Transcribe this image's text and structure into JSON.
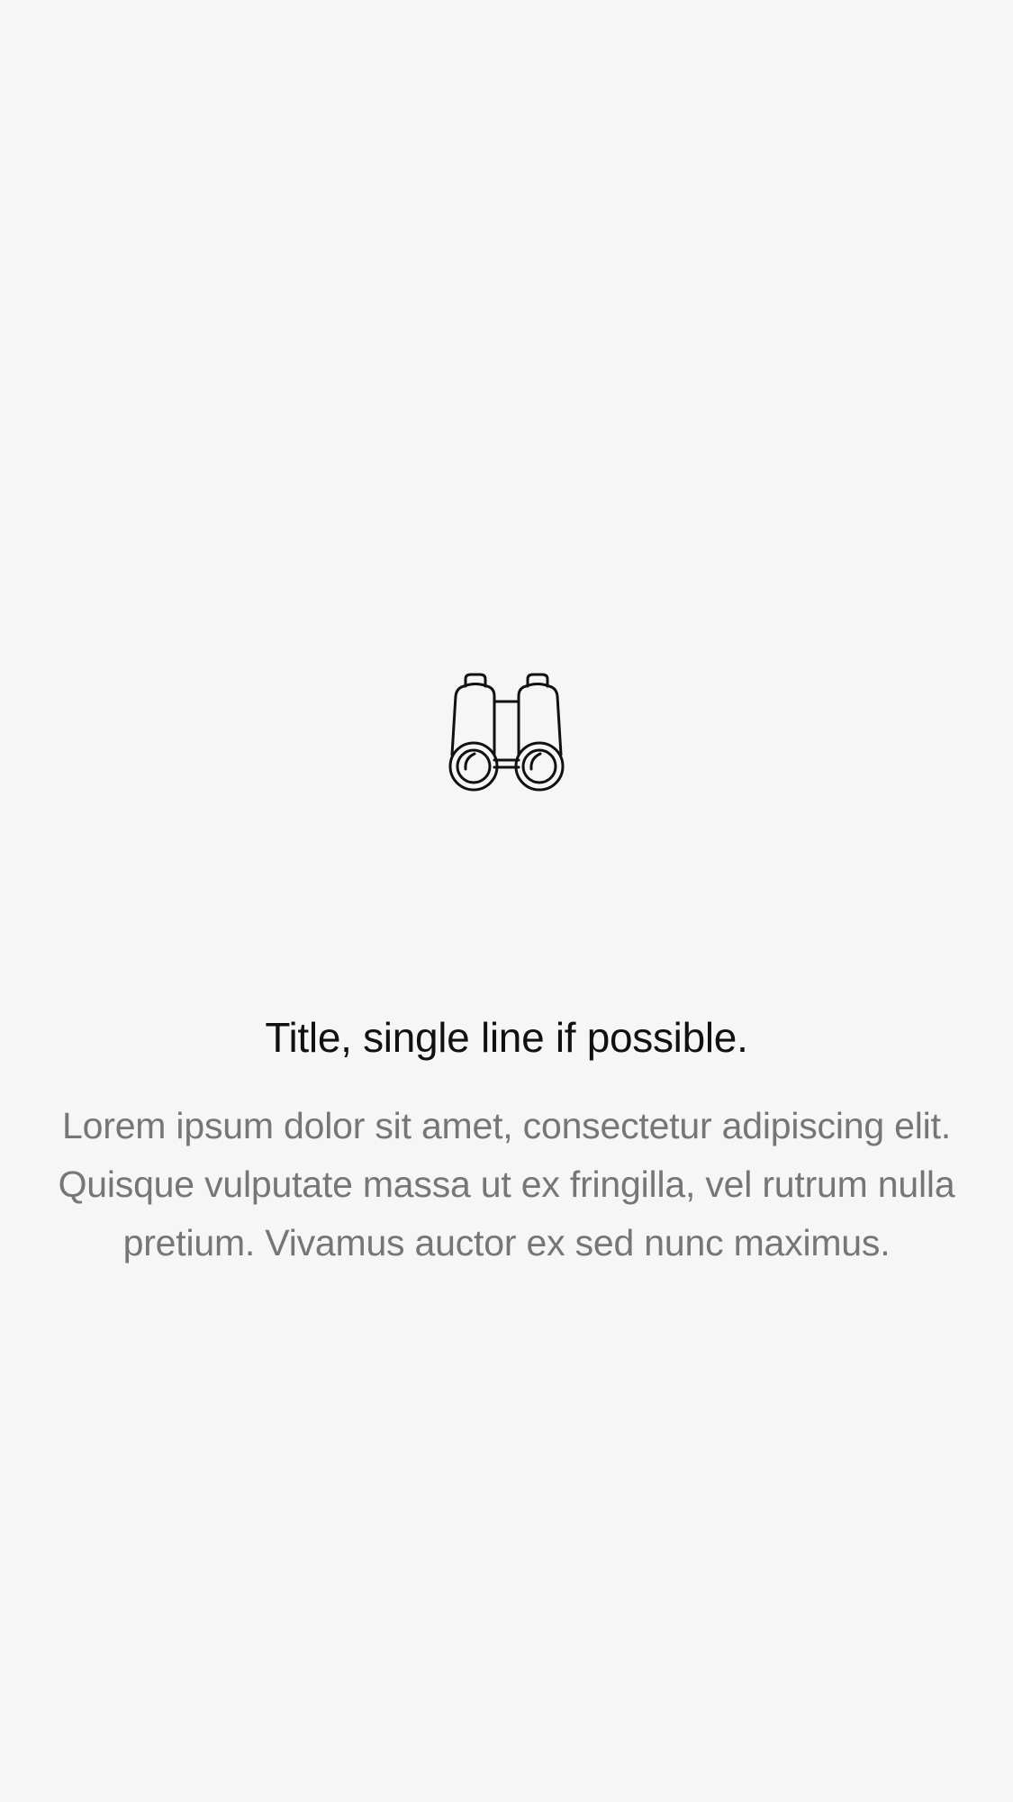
{
  "empty_state": {
    "icon": "binoculars-icon",
    "title": "Title, single line if possible.",
    "body": "Lorem ipsum dolor sit amet, consectetur adipiscing elit. Quisque vulputate massa ut ex fringilla, vel rutrum nulla pretium. Vivamus auctor ex sed nunc maximus."
  },
  "colors": {
    "background": "#f6f6f6",
    "title": "#111111",
    "body": "#767676",
    "icon_stroke": "#111111"
  }
}
